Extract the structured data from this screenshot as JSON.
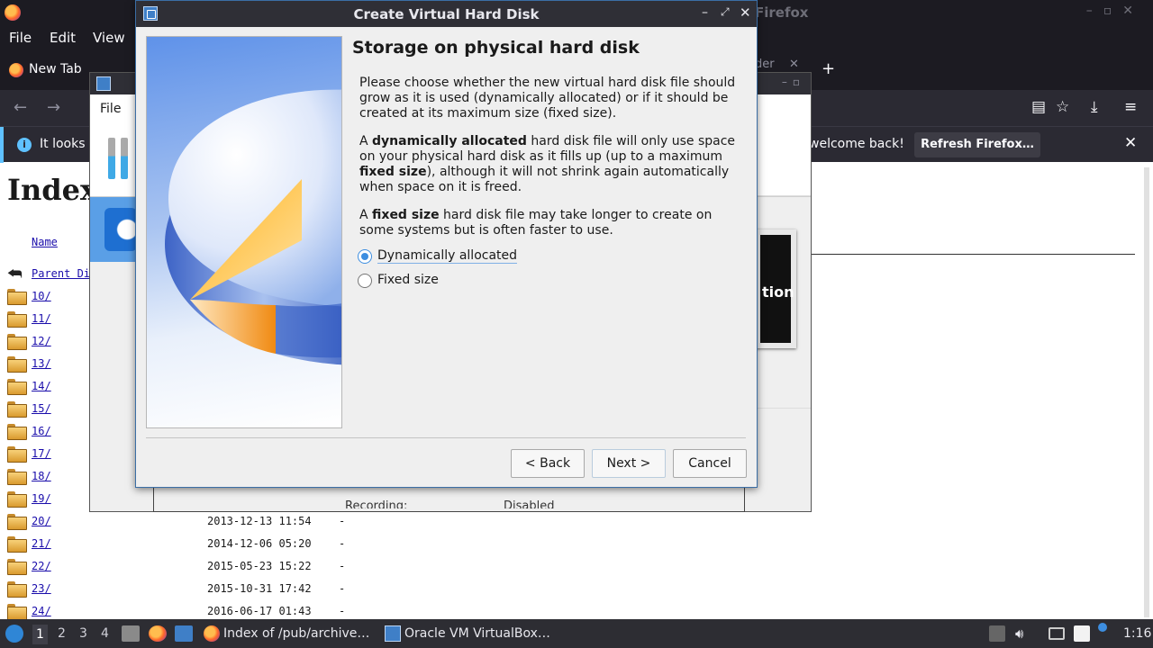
{
  "firefox": {
    "window_title": "Firefox",
    "menu": [
      "File",
      "Edit",
      "View"
    ],
    "tab_label": "New Tab",
    "tab2_partial": "der",
    "notification_left": "It looks l",
    "notification_right": "welcome back!",
    "refresh_button": "Refresh Firefox…"
  },
  "page": {
    "heading": "Index of /pub/archive",
    "name_header": "Name",
    "parent_dir": "Parent Directory",
    "rows": [
      {
        "name": "10/",
        "date": "",
        "size": ""
      },
      {
        "name": "11/",
        "date": "",
        "size": ""
      },
      {
        "name": "12/",
        "date": "",
        "size": ""
      },
      {
        "name": "13/",
        "date": "",
        "size": ""
      },
      {
        "name": "14/",
        "date": "",
        "size": ""
      },
      {
        "name": "15/",
        "date": "",
        "size": ""
      },
      {
        "name": "16/",
        "date": "",
        "size": ""
      },
      {
        "name": "17/",
        "date": "",
        "size": ""
      },
      {
        "name": "18/",
        "date": "",
        "size": ""
      },
      {
        "name": "19/",
        "date": "",
        "size": ""
      },
      {
        "name": "20/",
        "date": "2013-12-13 11:54",
        "size": "-"
      },
      {
        "name": "21/",
        "date": "2014-12-06 05:20",
        "size": "-"
      },
      {
        "name": "22/",
        "date": "2015-05-23 15:22",
        "size": "-"
      },
      {
        "name": "23/",
        "date": "2015-10-31 17:42",
        "size": "-"
      },
      {
        "name": "24/",
        "date": "2016-06-17 01:43",
        "size": "-"
      }
    ]
  },
  "vbox_main": {
    "menu_file": "File",
    "preview_text": "tion",
    "recording_label": "Recording:",
    "recording_value": "Disabled"
  },
  "dialog": {
    "title": "Create Virtual Hard Disk",
    "heading": "Storage on physical hard disk",
    "para1": "Please choose whether the new virtual hard disk file should grow as it is used (dynamically allocated) or if it should be created at its maximum size (fixed size).",
    "para2": {
      "pre": "A ",
      "bold1": "dynamically allocated",
      "mid1": " hard disk file will only use space on your physical hard disk as it fills up (up to a maximum ",
      "bold2": "fixed size",
      "post": "), although it will not shrink again automatically when space on it is freed."
    },
    "para3": {
      "pre": "A ",
      "bold": "fixed size",
      "post": " hard disk file may take longer to create on some systems but is often faster to use."
    },
    "options": [
      {
        "label": "Dynamically allocated",
        "checked": true
      },
      {
        "label": "Fixed size",
        "checked": false
      }
    ],
    "buttons": {
      "back": "< Back",
      "next": "Next >",
      "cancel": "Cancel"
    }
  },
  "taskbar": {
    "workspaces": [
      "1",
      "2",
      "3",
      "4"
    ],
    "tasks": [
      {
        "label": "Index of /pub/archive…"
      },
      {
        "label": "Oracle VM VirtualBox…"
      }
    ],
    "clock": "1:16"
  },
  "colors": {
    "accent": "#3d8ee0",
    "titlebar": "#2f2f36",
    "firefox_bg": "#1c1b22"
  }
}
